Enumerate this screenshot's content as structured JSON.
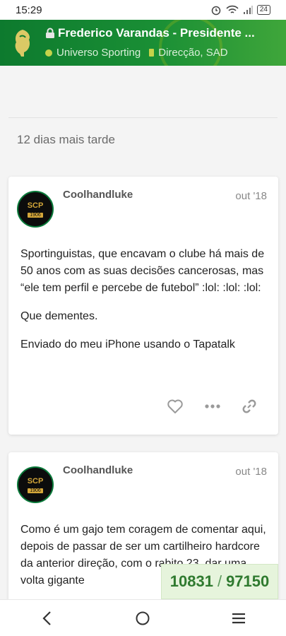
{
  "status": {
    "time": "15:29",
    "battery": "24"
  },
  "topic": {
    "title": "Frederico Varandas - Presidente ...",
    "category": "Universo Sporting",
    "subcategory": "Direcção, SAD"
  },
  "time_gap": "12 dias mais tarde",
  "posts": [
    {
      "username": "Coolhandluke",
      "date": "out '18",
      "avatar_text": "SCP",
      "avatar_year": "1906",
      "paragraphs": [
        "Sportinguistas, que encavam o clube há mais de 50 anos com as suas decisões cancerosas, mas “ele tem perfil e percebe de futebol” :lol: :lol: :lol:",
        "Que dementes.",
        "Enviado do meu iPhone usando o Tapatalk"
      ]
    },
    {
      "username": "Coolhandluke",
      "date": "out '18",
      "avatar_text": "SCP",
      "avatar_year": "1906",
      "paragraphs": [
        "Como é um gajo tem coragem de comentar aqui, depois de passar de ser um cartilheiro hardcore da anterior direção, com o rabito 23, dar uma volta gigante"
      ]
    }
  ],
  "progress": {
    "current": "10831",
    "separator": "/",
    "total": "97150"
  },
  "colors": {
    "header_green": "#1a8f35",
    "progress_text": "#2f7a2f"
  }
}
